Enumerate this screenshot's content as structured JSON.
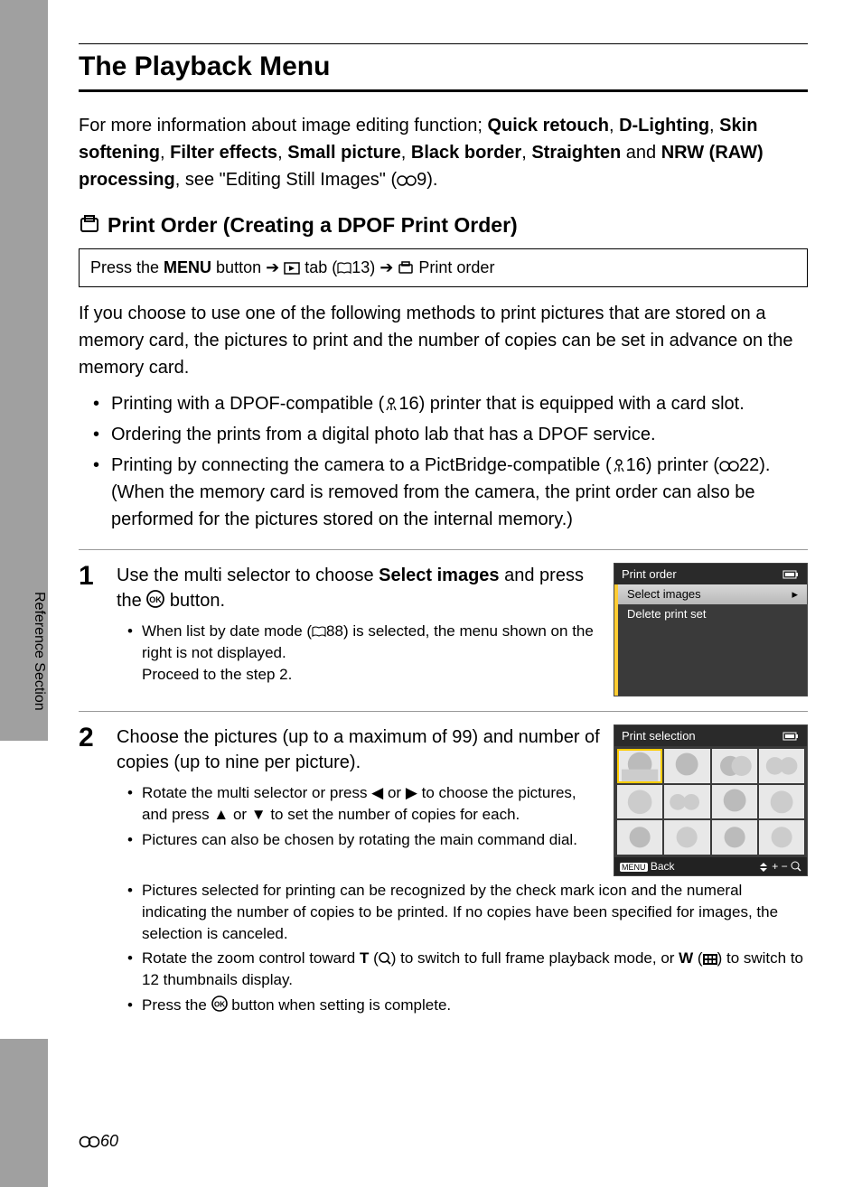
{
  "sidebar_label": "Reference Section",
  "title": "The Playback Menu",
  "intro_parts": {
    "a": "For more information about image editing function; ",
    "quick": "Quick retouch",
    "b": ", ",
    "dlight": "D-Lighting",
    "c": ", ",
    "skin": "Skin softening",
    "d": ", ",
    "filter": "Filter effects",
    "e": ", ",
    "small": "Small picture",
    "f": ", ",
    "black": "Black border",
    "g": ", ",
    "straight": "Straighten",
    "h": " and ",
    "nrw": "NRW (RAW) processing",
    "i": ", see \"Editing Still Images\" (",
    "ref": "9).",
    "link_icon": "🔗"
  },
  "subheading": "Print Order (Creating a DPOF Print Order)",
  "navbox": {
    "a": "Press the ",
    "menu": "MENU",
    "b": " button ",
    "arrow": "➔",
    "c": " tab (",
    "ref13": "13) ",
    "d": " Print order"
  },
  "para1": "If you choose to use one of the following methods to print pictures that are stored on a memory card, the pictures to print and the number of copies can be set in advance on the memory card.",
  "bullets": [
    {
      "a": "Printing with a DPOF-compatible (",
      "ref": "16) printer that is equipped with a card slot."
    },
    {
      "a": "Ordering the prints from a digital photo lab that has a DPOF service.",
      "ref": ""
    },
    {
      "a": "Printing by connecting the camera to a PictBridge-compatible (",
      "ref": "16) printer (",
      "ref2": "22). (When the memory card is removed from the camera, the print order can also be performed for the pictures stored on the internal memory.)"
    }
  ],
  "step1": {
    "num": "1",
    "title_a": "Use the multi selector to choose ",
    "title_b": "Select images",
    "title_c": " and press the ",
    "title_d": " button.",
    "sub_a": "When list by date mode (",
    "sub_ref": "88) is selected, the menu shown on the right is not displayed.",
    "sub_b": "Proceed to the step 2.",
    "screen": {
      "title": "Print order",
      "item1": "Select images",
      "item2": "Delete print set"
    }
  },
  "step2": {
    "num": "2",
    "title": "Choose the pictures (up to a maximum of 99) and number of copies (up to nine per picture).",
    "sub1_a": "Rotate the multi selector or press ",
    "sub1_b": " or ",
    "sub1_c": " to choose the pictures, and press ",
    "sub1_d": " or ",
    "sub1_e": " to set the number of copies for each.",
    "sub2": "Pictures can also be chosen by rotating the main command dial.",
    "sub3": "Pictures selected for printing can be recognized by the check mark icon and the numeral indicating the number of copies to be printed. If no copies have been specified for images, the selection is canceled.",
    "sub4_a": "Rotate the zoom control toward ",
    "sub4_T": "T",
    "sub4_b": " (",
    "sub4_c": ") to switch to full frame playback mode, or ",
    "sub4_W": "W",
    "sub4_d": " (",
    "sub4_e": ") to switch to 12 thumbnails display.",
    "sub5_a": "Press the ",
    "sub5_b": " button when setting is complete.",
    "screen": {
      "title": "Print selection",
      "back": "Back"
    }
  },
  "page_number": "60"
}
